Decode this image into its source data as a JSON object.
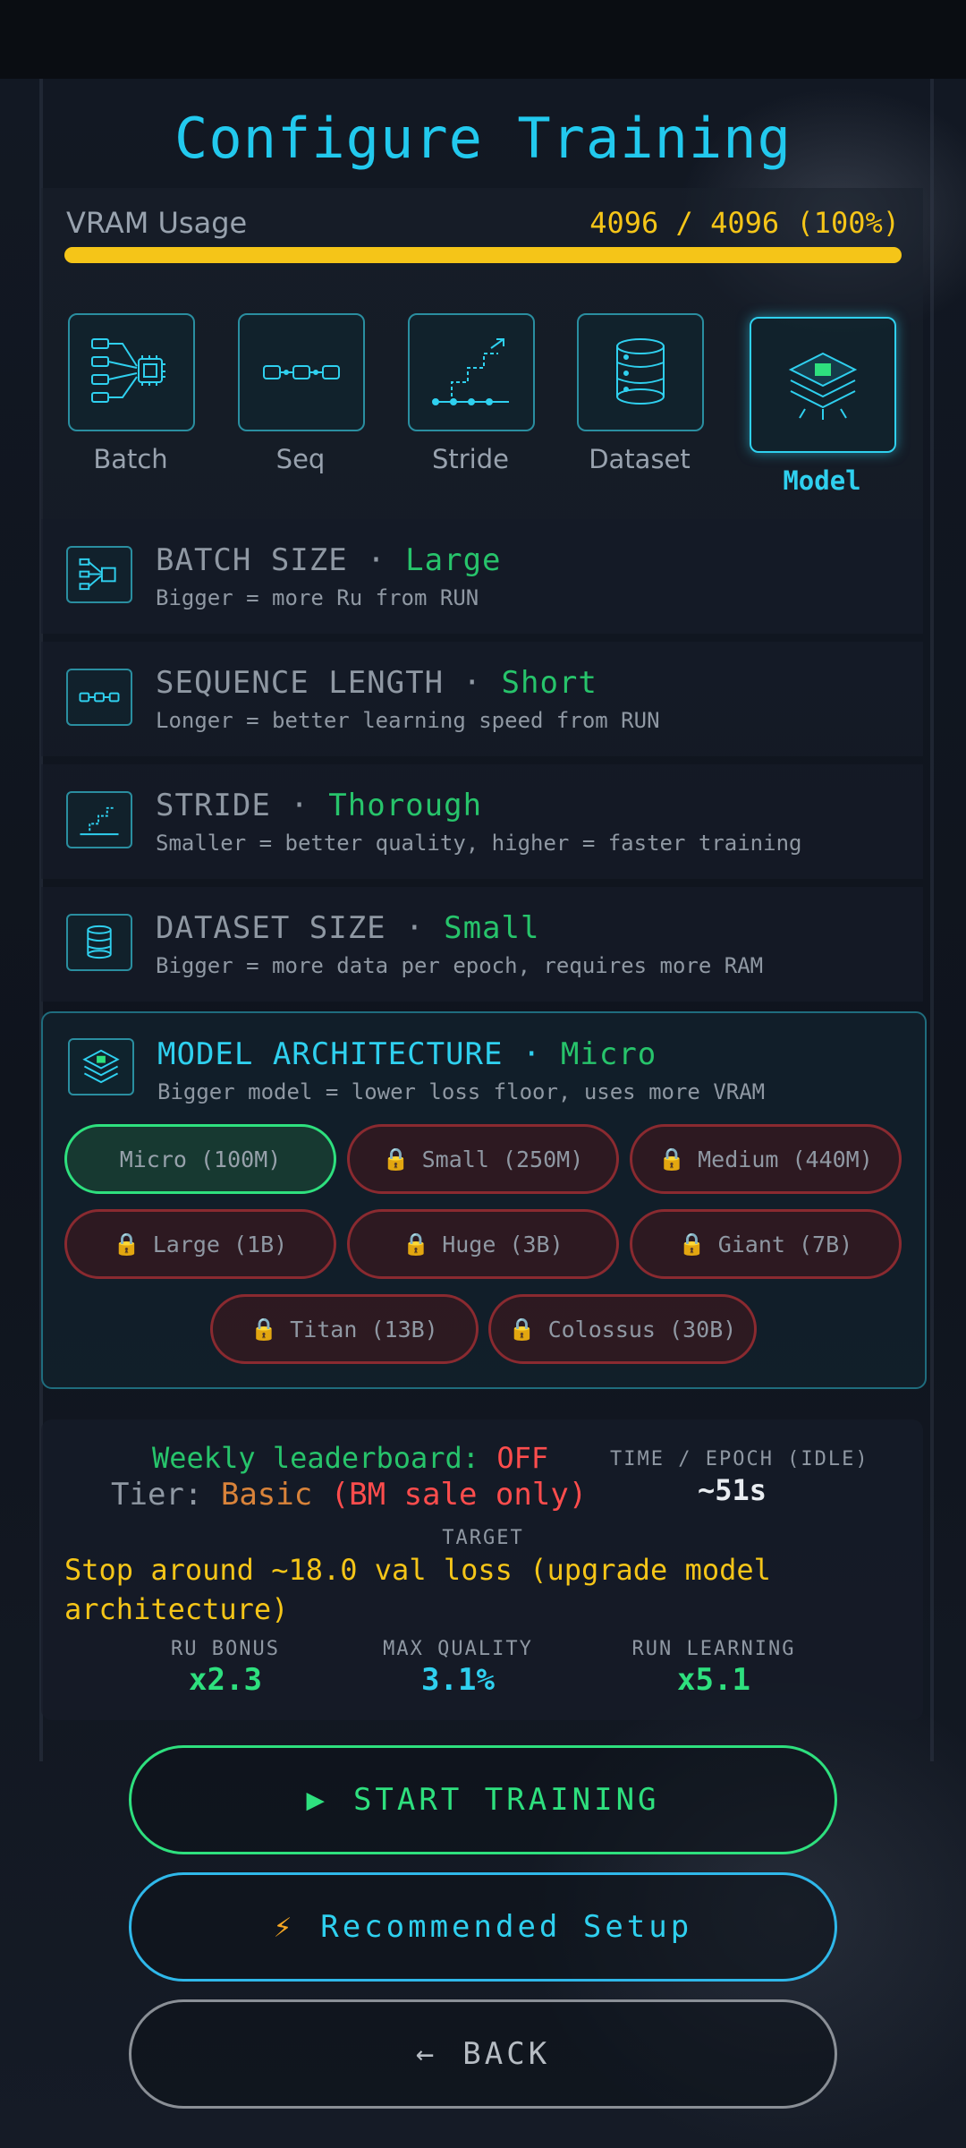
{
  "title": "Configure Training",
  "vram": {
    "label": "VRAM Usage",
    "value": "4096 / 4096 (100%)",
    "fraction": 1.0
  },
  "tabs": [
    {
      "label": "Batch",
      "icon": "batch-icon"
    },
    {
      "label": "Seq",
      "icon": "sequence-icon"
    },
    {
      "label": "Stride",
      "icon": "stride-icon"
    },
    {
      "label": "Dataset",
      "icon": "database-icon"
    },
    {
      "label": "Model",
      "icon": "chip-stack-icon",
      "active": true
    }
  ],
  "settings": [
    {
      "name": "BATCH SIZE",
      "sep": "·",
      "value": "Large",
      "desc": "Bigger = more Ru from RUN"
    },
    {
      "name": "SEQUENCE LENGTH",
      "sep": "·",
      "value": "Short",
      "desc": "Longer = better learning speed from RUN"
    },
    {
      "name": "STRIDE",
      "sep": "·",
      "value": "Thorough",
      "desc": "Smaller = better quality, higher = faster training"
    },
    {
      "name": "DATASET SIZE",
      "sep": "·",
      "value": "Small",
      "desc": "Bigger = more data per epoch, requires more RAM"
    }
  ],
  "model": {
    "name": "MODEL ARCHITECTURE",
    "sep": "·",
    "value": "Micro",
    "desc": "Bigger model = lower loss floor, uses more VRAM",
    "options": [
      {
        "label": "Micro (100M)",
        "locked": false,
        "selected": true
      },
      {
        "label": "Small (250M)",
        "locked": true
      },
      {
        "label": "Medium (440M)",
        "locked": true
      },
      {
        "label": "Large (1B)",
        "locked": true
      },
      {
        "label": "Huge (3B)",
        "locked": true
      },
      {
        "label": "Giant (7B)",
        "locked": true
      },
      {
        "label": "Titan (13B)",
        "locked": true
      },
      {
        "label": "Colossus (30B)",
        "locked": true
      }
    ],
    "lock_glyph": "🔒"
  },
  "info": {
    "leaderboard_label": "Weekly leaderboard:",
    "leaderboard_value": "OFF",
    "tier_label": "Tier:",
    "tier_value": "Basic",
    "tier_note": "(BM sale only)",
    "epoch_label": "TIME / EPOCH (IDLE)",
    "epoch_value": "~51s",
    "target_label": "TARGET",
    "target_text": "Stop around ~18.0 val loss (upgrade model architecture)",
    "stats": [
      {
        "label": "RU BONUS",
        "value": "x2.3",
        "color": "#2ee07e"
      },
      {
        "label": "MAX QUALITY",
        "value": "3.1%",
        "color": "#2fd0ef"
      },
      {
        "label": "RUN LEARNING",
        "value": "x5.1",
        "color": "#2ee07e"
      }
    ]
  },
  "buttons": {
    "start": {
      "icon": "▶",
      "label": "START TRAINING"
    },
    "recommended": {
      "icon": "⚡",
      "label": "Recommended Setup"
    },
    "back": {
      "icon": "←",
      "label": "BACK"
    }
  }
}
